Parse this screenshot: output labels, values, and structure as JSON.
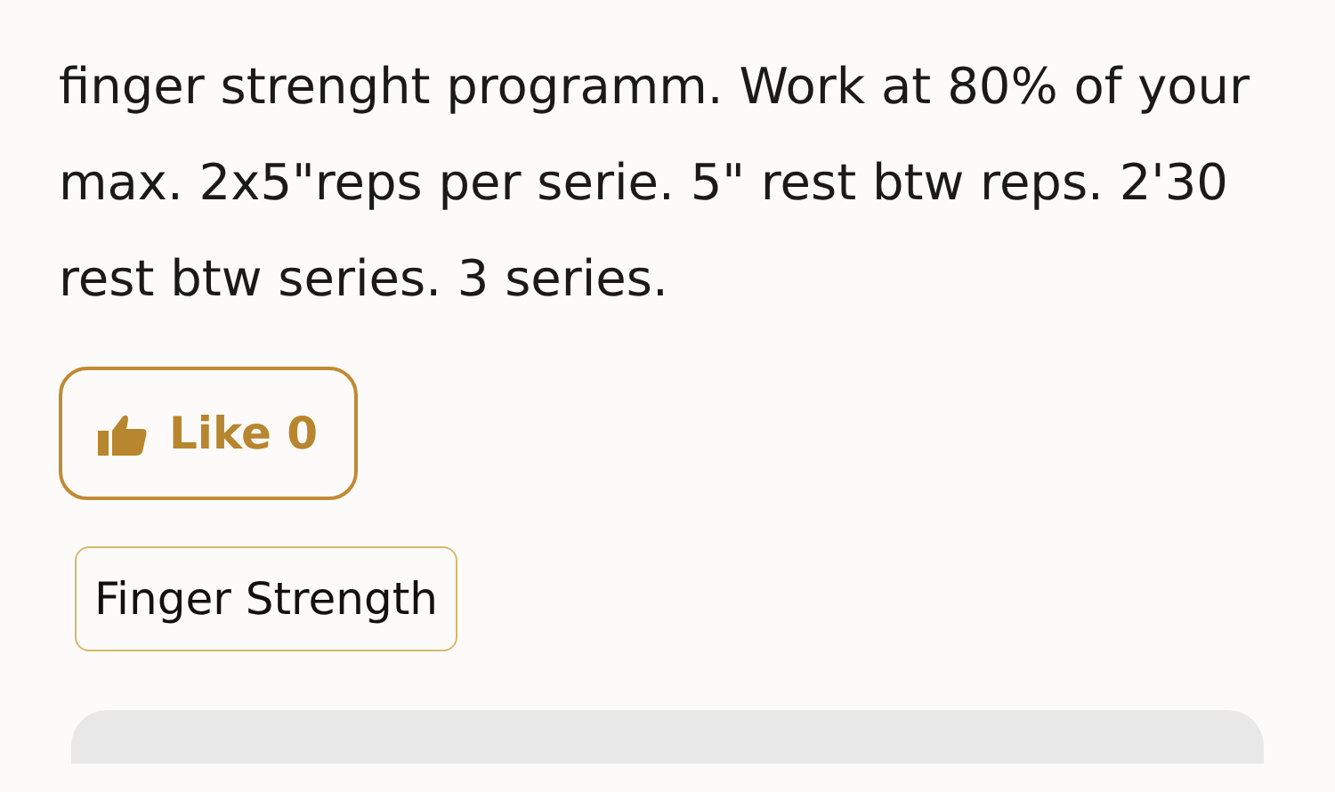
{
  "description": "finger strenght programm. Work at 80% of your max. 2x5\"reps per serie. 5\" rest btw reps. 2'30 rest btw series. 3 series.",
  "like_button": {
    "label": "Like",
    "count": "0"
  },
  "tags": [
    "Finger Strength"
  ]
}
